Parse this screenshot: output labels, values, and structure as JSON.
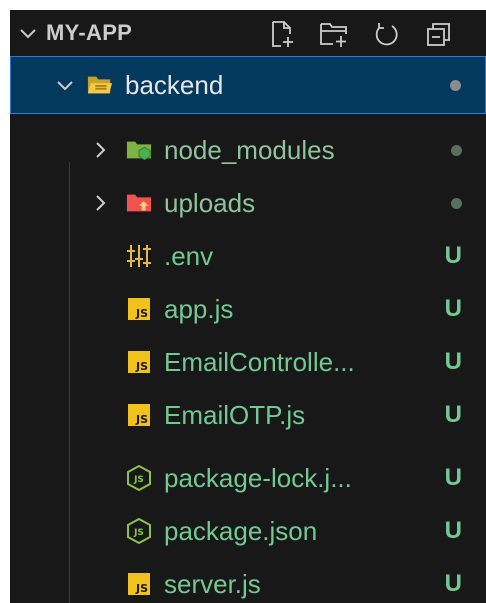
{
  "explorer": {
    "title": "MY-APP",
    "actions": [
      {
        "name": "new-file-icon"
      },
      {
        "name": "new-folder-icon"
      },
      {
        "name": "refresh-icon"
      },
      {
        "name": "collapse-all-icon"
      }
    ]
  },
  "tree": {
    "backend": {
      "label": "backend",
      "status_color": "#8b8b8b"
    },
    "items": [
      {
        "label": "node_modules",
        "kind": "folder",
        "status": "",
        "status_color": "#56705b"
      },
      {
        "label": "uploads",
        "kind": "folder",
        "status": "",
        "status_color": "#56705b"
      },
      {
        "label": ".env",
        "kind": "env",
        "status": "U"
      },
      {
        "label": "app.js",
        "kind": "js",
        "status": "U"
      },
      {
        "label": "EmailControlle...",
        "kind": "js",
        "status": "U"
      },
      {
        "label": "EmailOTP.js",
        "kind": "js",
        "status": "U"
      },
      {
        "label": "package-lock.j...",
        "kind": "json",
        "status": "U"
      },
      {
        "label": "package.json",
        "kind": "json",
        "status": "U"
      },
      {
        "label": "server.js",
        "kind": "js",
        "status": "U"
      }
    ],
    "js_icon_text": "JS"
  },
  "colors": {
    "untracked": "#73c991",
    "ignored_folder_label": "#8fc39a",
    "selection_bg": "#04395e",
    "selection_border": "#2b79d6"
  }
}
